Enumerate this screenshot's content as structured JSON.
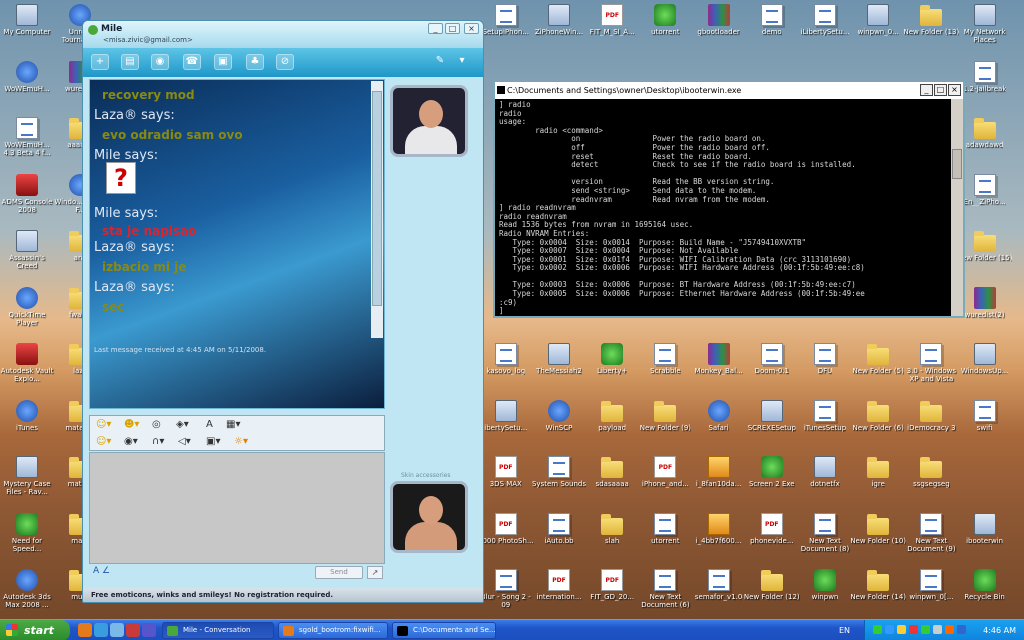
{
  "desktop_icons": [
    {
      "label": "My Computer",
      "type": "exe",
      "col": 0,
      "row": 0
    },
    {
      "label": "Unreal Tournam...",
      "type": "app",
      "col": 1,
      "row": 0
    },
    {
      "label": "SetupiPhon...",
      "type": "doc",
      "col": 9,
      "row": 0
    },
    {
      "label": "ZiPhoneWin...",
      "type": "exe",
      "col": 10,
      "row": 0
    },
    {
      "label": "FIT_M_SI_A...",
      "type": "pdf",
      "col": 11,
      "row": 0
    },
    {
      "label": "utorrent",
      "type": "green",
      "col": 12,
      "row": 0
    },
    {
      "label": "gbootloader",
      "type": "rar",
      "col": 13,
      "row": 0
    },
    {
      "label": "demo",
      "type": "doc",
      "col": 14,
      "row": 0
    },
    {
      "label": "iLibertySetu...",
      "type": "doc",
      "col": 15,
      "row": 0
    },
    {
      "label": "winpwn_0...",
      "type": "exe",
      "col": 16,
      "row": 0
    },
    {
      "label": "New Folder (13)",
      "type": "folder",
      "col": 17,
      "row": 0
    },
    {
      "label": "My Network Places",
      "type": "exe",
      "col": 18,
      "row": 0
    },
    {
      "label": "WoWEmuH...",
      "type": "app",
      "col": 0,
      "row": 1
    },
    {
      "label": "wuredi...",
      "type": "rar",
      "col": 1,
      "row": 1
    },
    {
      "label": "1.2-jailbreak",
      "type": "doc",
      "col": 18,
      "row": 1
    },
    {
      "label": "WoWEmuH... 4.3 Beta 4 f...",
      "type": "doc",
      "col": 0,
      "row": 2
    },
    {
      "label": "aaaaaa",
      "type": "folder",
      "col": 1,
      "row": 2
    },
    {
      "label": "adawdawd",
      "type": "folder",
      "col": 18,
      "row": 2
    },
    {
      "label": "ADMS Console 2008",
      "type": "red",
      "col": 0,
      "row": 3
    },
    {
      "label": "Windo... Media F...",
      "type": "app",
      "col": 1,
      "row": 3
    },
    {
      "label": "En__ZiPho...",
      "type": "doc",
      "col": 18,
      "row": 3
    },
    {
      "label": "Assassin's Creed",
      "type": "exe",
      "col": 0,
      "row": 4
    },
    {
      "label": "ana",
      "type": "folder",
      "col": 1,
      "row": 4
    },
    {
      "label": "New Folder (15)",
      "type": "folder",
      "col": 18,
      "row": 4
    },
    {
      "label": "QuickTime Player",
      "type": "app",
      "col": 0,
      "row": 5
    },
    {
      "label": "fwaaw",
      "type": "folder",
      "col": 1,
      "row": 5
    },
    {
      "label": "wuredist(2)",
      "type": "rar",
      "col": 18,
      "row": 5
    },
    {
      "label": "Autodesk Vault Explo...",
      "type": "red",
      "col": 0,
      "row": 6
    },
    {
      "label": "laza",
      "type": "folder",
      "col": 1,
      "row": 6
    },
    {
      "label": "kasovo_log",
      "type": "doc",
      "col": 9,
      "row": 6
    },
    {
      "label": "TheMessiah2",
      "type": "exe",
      "col": 10,
      "row": 6
    },
    {
      "label": "Liberty+",
      "type": "green",
      "col": 11,
      "row": 6
    },
    {
      "label": "Scrabble",
      "type": "doc",
      "col": 12,
      "row": 6
    },
    {
      "label": "Monkey_Bal...",
      "type": "rar",
      "col": 13,
      "row": 6
    },
    {
      "label": "Doom-0.1",
      "type": "doc",
      "col": 14,
      "row": 6
    },
    {
      "label": "DFU",
      "type": "doc",
      "col": 15,
      "row": 6
    },
    {
      "label": "New Folder (5)",
      "type": "folder",
      "col": 16,
      "row": 6
    },
    {
      "label": "3.0 - Windows XP and Vista",
      "type": "doc",
      "col": 17,
      "row": 6
    },
    {
      "label": "WindowsUp...",
      "type": "exe",
      "col": 18,
      "row": 6
    },
    {
      "label": "iTunes",
      "type": "app",
      "col": 0,
      "row": 7
    },
    {
      "label": "materi...",
      "type": "folder",
      "col": 1,
      "row": 7
    },
    {
      "label": "ibertySetu...",
      "type": "exe",
      "col": 9,
      "row": 7
    },
    {
      "label": "WinSCP",
      "type": "app",
      "col": 10,
      "row": 7
    },
    {
      "label": "payload",
      "type": "folder",
      "col": 11,
      "row": 7
    },
    {
      "label": "New Folder (9)",
      "type": "folder",
      "col": 12,
      "row": 7
    },
    {
      "label": "Safari",
      "type": "app",
      "col": 13,
      "row": 7
    },
    {
      "label": "SCREXESetup",
      "type": "exe",
      "col": 14,
      "row": 7
    },
    {
      "label": "iTunesSetup",
      "type": "doc",
      "col": 15,
      "row": 7
    },
    {
      "label": "New Folder (6)",
      "type": "folder",
      "col": 16,
      "row": 7
    },
    {
      "label": "iDemocracy 3",
      "type": "folder",
      "col": 17,
      "row": 7
    },
    {
      "label": "swifi",
      "type": "doc",
      "col": 18,
      "row": 7
    },
    {
      "label": "Mystery Case Files - Rav...",
      "type": "exe",
      "col": 0,
      "row": 8
    },
    {
      "label": "matu...",
      "type": "folder",
      "col": 1,
      "row": 8
    },
    {
      "label": "3DS MAX",
      "type": "pdf",
      "col": 9,
      "row": 8
    },
    {
      "label": "System Sounds",
      "type": "doc",
      "col": 10,
      "row": 8
    },
    {
      "label": "sdasaaaa",
      "type": "folder",
      "col": 11,
      "row": 8
    },
    {
      "label": "iPhone_and...",
      "type": "pdf",
      "col": 12,
      "row": 8
    },
    {
      "label": "i_8fan10da...",
      "type": "jpg",
      "col": 13,
      "row": 8
    },
    {
      "label": "Screen 2 Exe",
      "type": "green",
      "col": 14,
      "row": 8
    },
    {
      "label": "dotnetfx",
      "type": "exe",
      "col": 15,
      "row": 8
    },
    {
      "label": "igre",
      "type": "folder",
      "col": 16,
      "row": 8
    },
    {
      "label": "ssgsegseg",
      "type": "folder",
      "col": 17,
      "row": 8
    },
    {
      "label": "Need for Speed...",
      "type": "green",
      "col": 0,
      "row": 9
    },
    {
      "label": "ma...",
      "type": "folder",
      "col": 1,
      "row": 9
    },
    {
      "label": "1000 PhotoSh...",
      "type": "pdf",
      "col": 9,
      "row": 9
    },
    {
      "label": "iAuto.bb",
      "type": "doc",
      "col": 10,
      "row": 9
    },
    {
      "label": "slah",
      "type": "folder",
      "col": 11,
      "row": 9
    },
    {
      "label": "utorrent",
      "type": "doc",
      "col": 12,
      "row": 9
    },
    {
      "label": "i_4bb7f600...",
      "type": "jpg",
      "col": 13,
      "row": 9
    },
    {
      "label": "phonevide...",
      "type": "pdf",
      "col": 14,
      "row": 9
    },
    {
      "label": "New Text Document (8)",
      "type": "doc",
      "col": 15,
      "row": 9
    },
    {
      "label": "New Folder (10)",
      "type": "folder",
      "col": 16,
      "row": 9
    },
    {
      "label": "New Text Document (9)",
      "type": "doc",
      "col": 17,
      "row": 9
    },
    {
      "label": "ibooterwin",
      "type": "exe",
      "col": 18,
      "row": 9
    },
    {
      "label": "Autodesk 3ds Max 2008 ...",
      "type": "app",
      "col": 0,
      "row": 10
    },
    {
      "label": "mu...",
      "type": "folder",
      "col": 1,
      "row": 10
    },
    {
      "label": "Blur - Song 2 - 09",
      "type": "doc",
      "col": 9,
      "row": 10
    },
    {
      "label": "internation...",
      "type": "pdf",
      "col": 10,
      "row": 10
    },
    {
      "label": "FIT_GD_20...",
      "type": "pdf",
      "col": 11,
      "row": 10
    },
    {
      "label": "New Text Document (6)",
      "type": "doc",
      "col": 12,
      "row": 10
    },
    {
      "label": "semafor_v1.0",
      "type": "doc",
      "col": 13,
      "row": 10
    },
    {
      "label": "New Folder (12)",
      "type": "folder",
      "col": 14,
      "row": 10
    },
    {
      "label": "winpwn",
      "type": "green",
      "col": 15,
      "row": 10
    },
    {
      "label": "New Folder (14)",
      "type": "folder",
      "col": 16,
      "row": 10
    },
    {
      "label": "winpwn_0[...",
      "type": "doc",
      "col": 17,
      "row": 10
    },
    {
      "label": "Recycle Bin",
      "type": "green",
      "col": 18,
      "row": 10
    }
  ],
  "messenger": {
    "title": "Mile",
    "email": "<misa.zivic@gmail.com>",
    "window_buttons": [
      "_",
      "□",
      "×"
    ],
    "toolbar_icons": [
      "invite-icon",
      "send-files-icon",
      "webcam-icon",
      "call-icon",
      "activities-icon",
      "games-icon",
      "block-icon",
      "paint-icon",
      "menu-icon"
    ],
    "messages": [
      {
        "kind": "msg",
        "text": "recovery mod",
        "color": "#8a8a10"
      },
      {
        "kind": "said",
        "text": "Laza® says:"
      },
      {
        "kind": "msg",
        "text": "evo odradio sam ovo",
        "color": "#8a8a10"
      },
      {
        "kind": "said",
        "text": "Mile says:"
      },
      {
        "kind": "emoticon",
        "text": "?"
      },
      {
        "kind": "said",
        "text": "Mile says:"
      },
      {
        "kind": "msg",
        "text": "sta je napisao",
        "color": "#e0222a"
      },
      {
        "kind": "said",
        "text": "Laza® says:"
      },
      {
        "kind": "msg",
        "text": "izbacio mi je",
        "color": "#8a8a10"
      },
      {
        "kind": "said",
        "text": "Laza® says:"
      },
      {
        "kind": "msg",
        "text": "sec",
        "color": "#8a8a10"
      }
    ],
    "last_message": "Last message received at 4:45 AM on 5/11/2008.",
    "show_accessories": "Skin accessories",
    "send_label": "Send",
    "search_label": "↗",
    "banner": "Free emoticons, winks and smileys! No registration required."
  },
  "cmd": {
    "title": "C:\\Documents and Settings\\owner\\Desktop\\ibooterwin.exe",
    "lines": [
      "] radio",
      "radio",
      "usage:",
      "        radio <command>",
      "                on                Power the radio board on.",
      "                off               Power the radio board off.",
      "                reset             Reset the radio board.",
      "                detect            Check to see if the radio board is installed.",
      "",
      "                version           Read the BB version string.",
      "                send <string>     Send data to the modem.",
      "                readnvram         Read nvram from the modem.",
      "] radio readnvram",
      "radio readnvram",
      "Read 1536 bytes from nvram in 1695164 usec.",
      "Radio NVRAM Entries:",
      "   Type: 0x0004  Size: 0x0014  Purpose: Build Name - \"J5749410XVXTB\"",
      "   Type: 0x0007  Size: 0x0004  Purpose: Not Available",
      "   Type: 0x0001  Size: 0x01f4  Purpose: WIFI Calibration Data (crc 3113101690)",
      "   Type: 0x0002  Size: 0x0006  Purpose: WIFI Hardware Address (00:1f:5b:49:ee:c8)",
      "",
      "   Type: 0x0003  Size: 0x0006  Purpose: BT Hardware Address (00:1f:5b:49:ee:c7)",
      "   Type: 0x0005  Size: 0x0006  Purpose: Ethernet Hardware Address (00:1f:5b:49:ee",
      ":c9)",
      "]"
    ]
  },
  "taskbar": {
    "start": "start",
    "tasks": [
      {
        "label": "Mile - Conversation",
        "active": true
      },
      {
        "label": "sgold_bootrom:fixwifi...",
        "active": false
      },
      {
        "label": "C:\\Documents and Se...",
        "active": false
      }
    ],
    "lang": "EN",
    "clock": "4:46 AM"
  }
}
